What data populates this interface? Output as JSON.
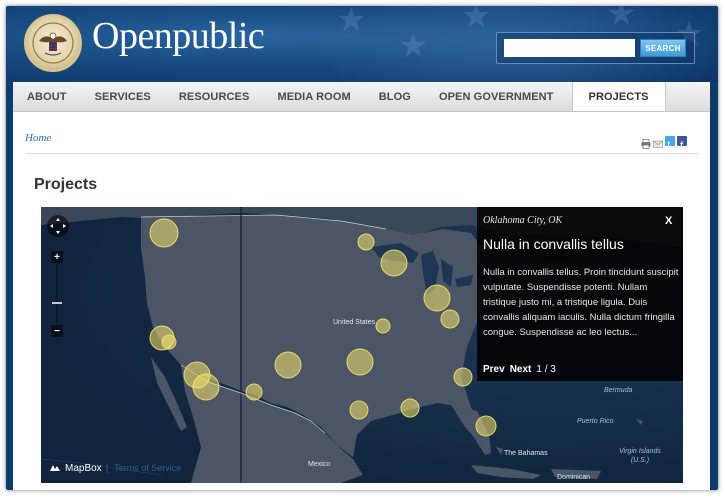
{
  "site": {
    "name": "Openpublic",
    "colors": {
      "header_blue": "#164a80",
      "accent_blue": "#2b6cb0",
      "marker_fill": "#f5e36a"
    }
  },
  "search": {
    "placeholder": "",
    "button_label": "SEARCH"
  },
  "nav": {
    "items": [
      {
        "label": "ABOUT",
        "active": false
      },
      {
        "label": "SERVICES",
        "active": false
      },
      {
        "label": "RESOURCES",
        "active": false
      },
      {
        "label": "MEDIA ROOM",
        "active": false
      },
      {
        "label": "BLOG",
        "active": false
      },
      {
        "label": "OPEN GOVERNMENT",
        "active": false
      },
      {
        "label": "PROJECTS",
        "active": true
      }
    ]
  },
  "breadcrumb": {
    "home": "Home"
  },
  "share": {
    "icons": [
      "print-icon",
      "email-icon",
      "twitter-icon",
      "facebook-icon"
    ]
  },
  "page": {
    "title": "Projects"
  },
  "map": {
    "labels": {
      "united_states": "United States",
      "mexico": "Mexico",
      "bermuda": "Bermuda",
      "puerto_rico": "Puerto Rico",
      "virgin_islands": "Virgin Islands\n(U.S.)",
      "the_bahamas": "The Bahamas",
      "dominican": "Dominican"
    },
    "controls": {
      "zoom_in": "+",
      "zoom_out": "−"
    },
    "attribution": {
      "provider": "MapBox",
      "terms": "Terms of Service"
    },
    "popup": {
      "location": "Oklahoma City, OK",
      "close": "X",
      "title": "Nulla in convallis tellus",
      "body": "Nulla in convallis tellus. Proin tincidunt suscipit vulputate. Suspendisse potenti. Nullam tristique justo mi, a tristique ligula. Duis convallis aliquam iaculis. Nulla dictum fringilla congue. Suspendisse ac leo lectus...",
      "prev": "Prev",
      "next": "Next",
      "pager": "1 / 3"
    }
  }
}
